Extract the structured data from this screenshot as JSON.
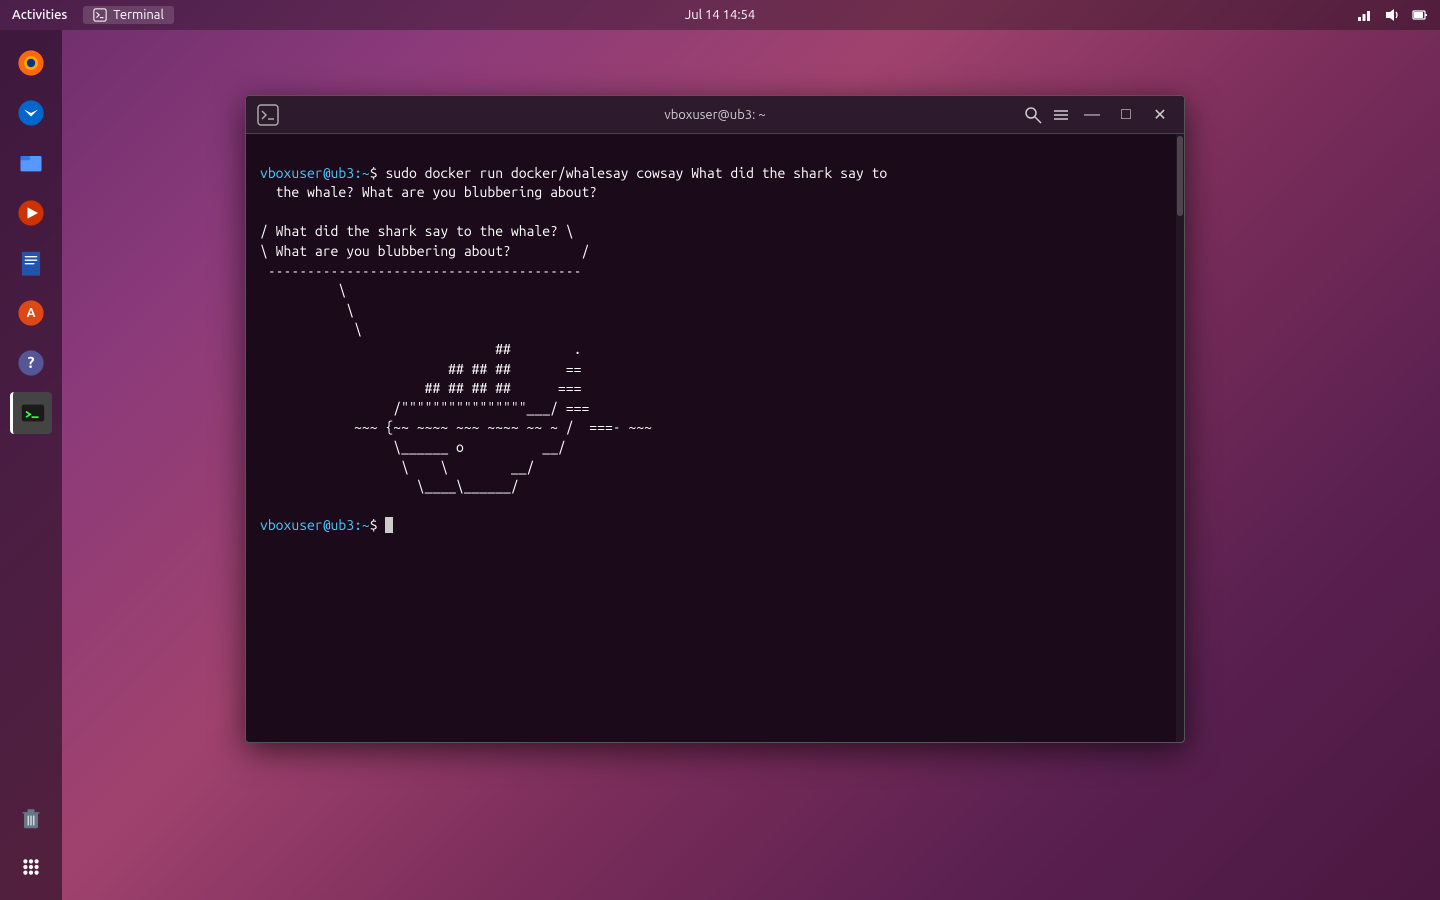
{
  "topbar": {
    "activities": "Activities",
    "terminal_label": "Terminal",
    "datetime": "Jul 14  14:54"
  },
  "terminal": {
    "title": "vboxuser@ub3: ~",
    "command_line1": "vboxuser@ub3:",
    "command_prompt": "~$ ",
    "command": "sudo docker run docker/whalesay cowsay What did the shark say to",
    "command_cont": "  the whale? What are you blubbering about?",
    "output": "/ What did the shark say to the whale? \\\n\\ What are you blubbering about?         /\n ----------------------------------------\n          \\\n           \\\n            \\\n                              ##        .\n                        ## ## ##       ==\n                     ## ## ## ##      ===\n                 /\"\"\"\"\"\"\"\"\"\"\"\"\"\"\"\"___/ ===\n            ~~~ {~~ ~~~~ ~~~ ~~~~ ~~ ~ /  ===- ~~~\n                 \\______ o          __/\n                  \\    \\        __/\n                    \\____\\______/",
    "prompt2_user": "vboxuser@ub3:",
    "prompt2": "~$ "
  },
  "sidebar": {
    "firefox_label": "Firefox",
    "thunderbird_label": "Thunderbird",
    "files_label": "Files",
    "rhythmbox_label": "Rhythmbox",
    "writer_label": "LibreOffice Writer",
    "appstore_label": "App Store",
    "help_label": "Help",
    "terminal_label": "Terminal",
    "trash_label": "Trash",
    "apps_label": "Show Applications"
  },
  "window_buttons": {
    "minimize": "—",
    "maximize": "□",
    "close": "✕"
  }
}
